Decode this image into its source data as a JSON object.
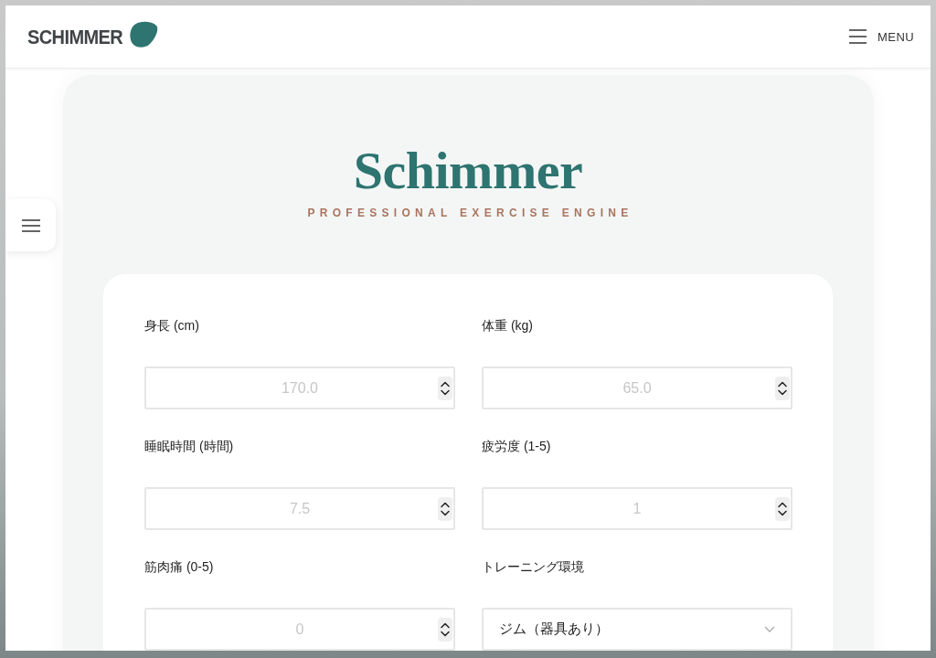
{
  "header": {
    "logo": "SCHIMMER",
    "menu_label": "MENU"
  },
  "hero": {
    "title": "Schimmer",
    "subtitle": "PROFESSIONAL EXERCISE ENGINE"
  },
  "form": {
    "fields": [
      {
        "label": "身長 (cm)",
        "kind": "number",
        "placeholder": "170.0"
      },
      {
        "label": "体重 (kg)",
        "kind": "number",
        "placeholder": "65.0"
      },
      {
        "label": "睡眠時間 (時間)",
        "kind": "number",
        "placeholder": "7.5"
      },
      {
        "label": "疲労度 (1-5)",
        "kind": "number",
        "placeholder": "1"
      },
      {
        "label": "筋肉痛 (0-5)",
        "kind": "number",
        "placeholder": "0"
      },
      {
        "label": "トレーニング環境",
        "kind": "select",
        "value": "ジム（器具あり）"
      }
    ]
  }
}
